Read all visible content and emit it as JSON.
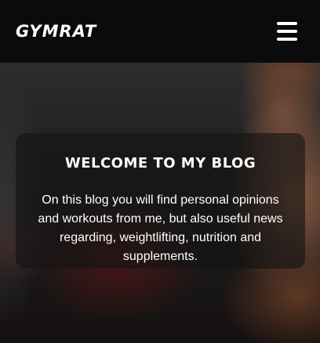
{
  "navbar": {
    "logo_text": "GYMRAT",
    "menu_icon": "hamburger-menu-icon"
  },
  "hero": {
    "background_image": "bearded-man-photo"
  },
  "welcome": {
    "title": "WELCOME TO MY BLOG",
    "text": "On this blog you will find personal opinions and workouts from me, but also useful news regarding, weightlifting, nutrition and supplements."
  }
}
